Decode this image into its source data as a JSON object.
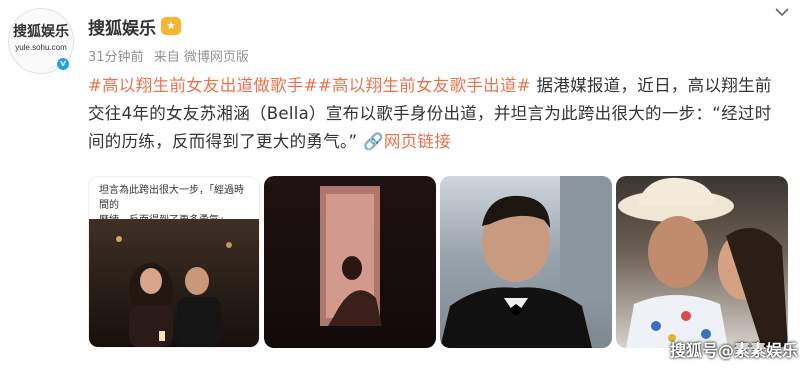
{
  "account": {
    "name": "搜狐娱乐",
    "avatar_title": "搜狐娱乐",
    "avatar_url": "yule.sohu.com",
    "verified_symbol": "v"
  },
  "meta": {
    "time": "31分钟前",
    "source": "来自 微博网页版"
  },
  "post": {
    "topic1": "#高以翔生前女友出道做歌手#",
    "topic2": "#高以翔生前女友歌手出道#",
    "body": " 据港媒报道，近日，高以翔生前交往4年的女友苏湘涵（Bella）宣布以歌手身份出道，并坦言为此跨出很大的一步：“经过时间的历练，反而得到了更大的勇气。” ",
    "link_label": "网页链接"
  },
  "thumbnails": {
    "caption_line1": "坦言為此跨出很大一步，「經過時間的",
    "caption_line2": "歷練，反而得到了更多勇氣」。"
  },
  "watermark": "搜狐号@素素娱乐",
  "colors": {
    "topic": "#eb7350",
    "meta": "#939393",
    "verified": "#1da1f2"
  }
}
